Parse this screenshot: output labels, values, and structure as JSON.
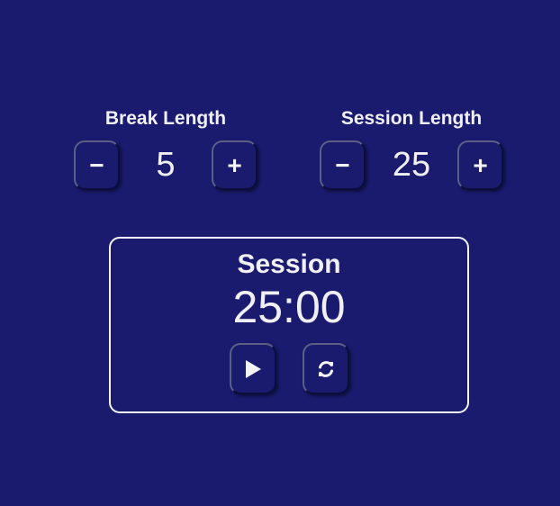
{
  "break": {
    "label": "Break Length",
    "value": "5",
    "decrement_icon": "minus-icon",
    "increment_icon": "plus-icon"
  },
  "session": {
    "label": "Session Length",
    "value": "25",
    "decrement_icon": "minus-icon",
    "increment_icon": "plus-icon"
  },
  "timer": {
    "label": "Session",
    "time": "25:00",
    "start_icon": "play-icon",
    "reset_icon": "refresh-icon"
  },
  "colors": {
    "background": "#1a1a6e",
    "text": "#f0f0f4",
    "border": "#f4f4f8"
  }
}
